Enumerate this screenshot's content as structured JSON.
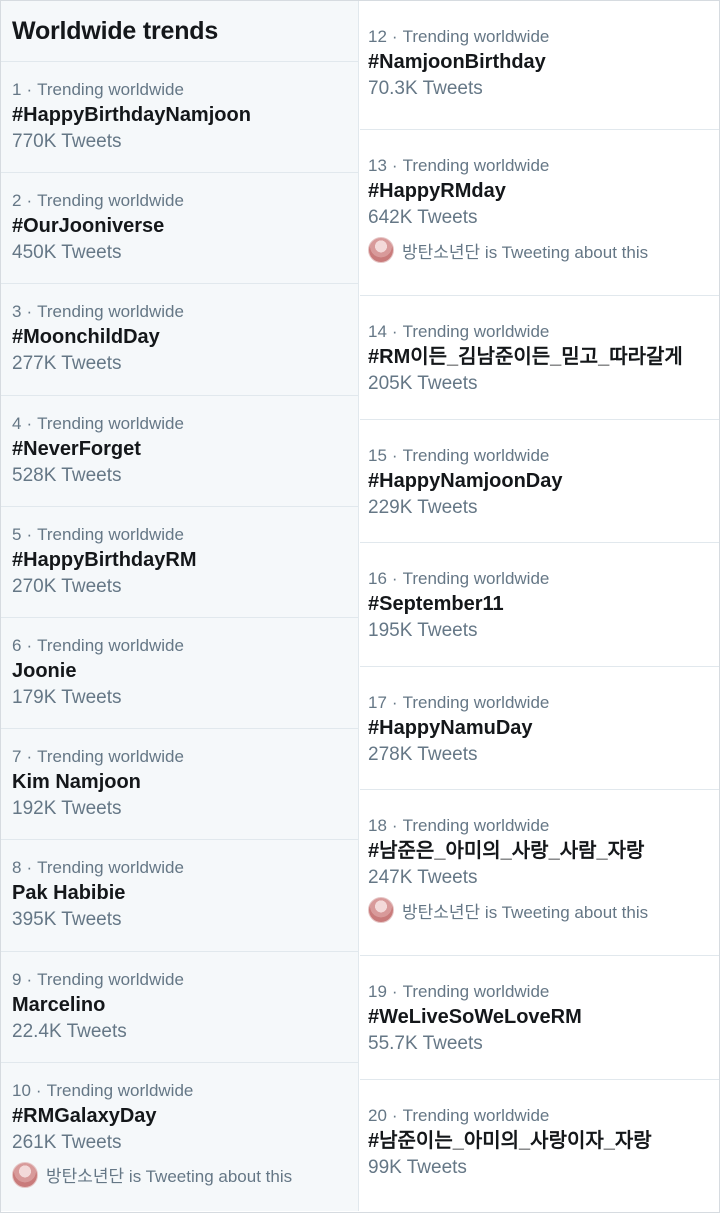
{
  "header": {
    "title": "Worldwide trends"
  },
  "trend_meta_label": "Trending worldwide",
  "left_trends": [
    {
      "rank": "1",
      "name": "#HappyBirthdayNamjoon",
      "count": "770K Tweets"
    },
    {
      "rank": "2",
      "name": "#OurJooniverse",
      "count": "450K Tweets"
    },
    {
      "rank": "3",
      "name": "#MoonchildDay",
      "count": "277K Tweets"
    },
    {
      "rank": "4",
      "name": "#NeverForget",
      "count": "528K Tweets"
    },
    {
      "rank": "5",
      "name": "#HappyBirthdayRM",
      "count": "270K Tweets"
    },
    {
      "rank": "6",
      "name": "Joonie",
      "count": "179K Tweets"
    },
    {
      "rank": "7",
      "name": "Kim Namjoon",
      "count": "192K Tweets"
    },
    {
      "rank": "8",
      "name": "Pak Habibie",
      "count": "395K Tweets"
    },
    {
      "rank": "9",
      "name": "Marcelino",
      "count": "22.4K Tweets"
    },
    {
      "rank": "10",
      "name": "#RMGalaxyDay",
      "count": "261K Tweets",
      "context": "방탄소년단 is Tweeting about this"
    }
  ],
  "right_trends": [
    {
      "rank": "12",
      "name": "#NamjoonBirthday",
      "count": "70.3K Tweets"
    },
    {
      "rank": "13",
      "name": "#HappyRMday",
      "count": "642K Tweets",
      "context": "방탄소년단 is Tweeting about this"
    },
    {
      "rank": "14",
      "name": "#RM이든_김남준이든_믿고_따라갈게",
      "count": "205K Tweets"
    },
    {
      "rank": "15",
      "name": "#HappyNamjoonDay",
      "count": "229K Tweets"
    },
    {
      "rank": "16",
      "name": "#September11",
      "count": "195K Tweets"
    },
    {
      "rank": "17",
      "name": "#HappyNamuDay",
      "count": "278K Tweets"
    },
    {
      "rank": "18",
      "name": "#남준은_아미의_사랑_사람_자랑",
      "count": "247K Tweets",
      "context": "방탄소년단 is Tweeting about this"
    },
    {
      "rank": "19",
      "name": "#WeLiveSoWeLoveRM",
      "count": "55.7K Tweets"
    },
    {
      "rank": "20",
      "name": "#남준이는_아미의_사랑이자_자랑",
      "count": "99K Tweets"
    }
  ]
}
